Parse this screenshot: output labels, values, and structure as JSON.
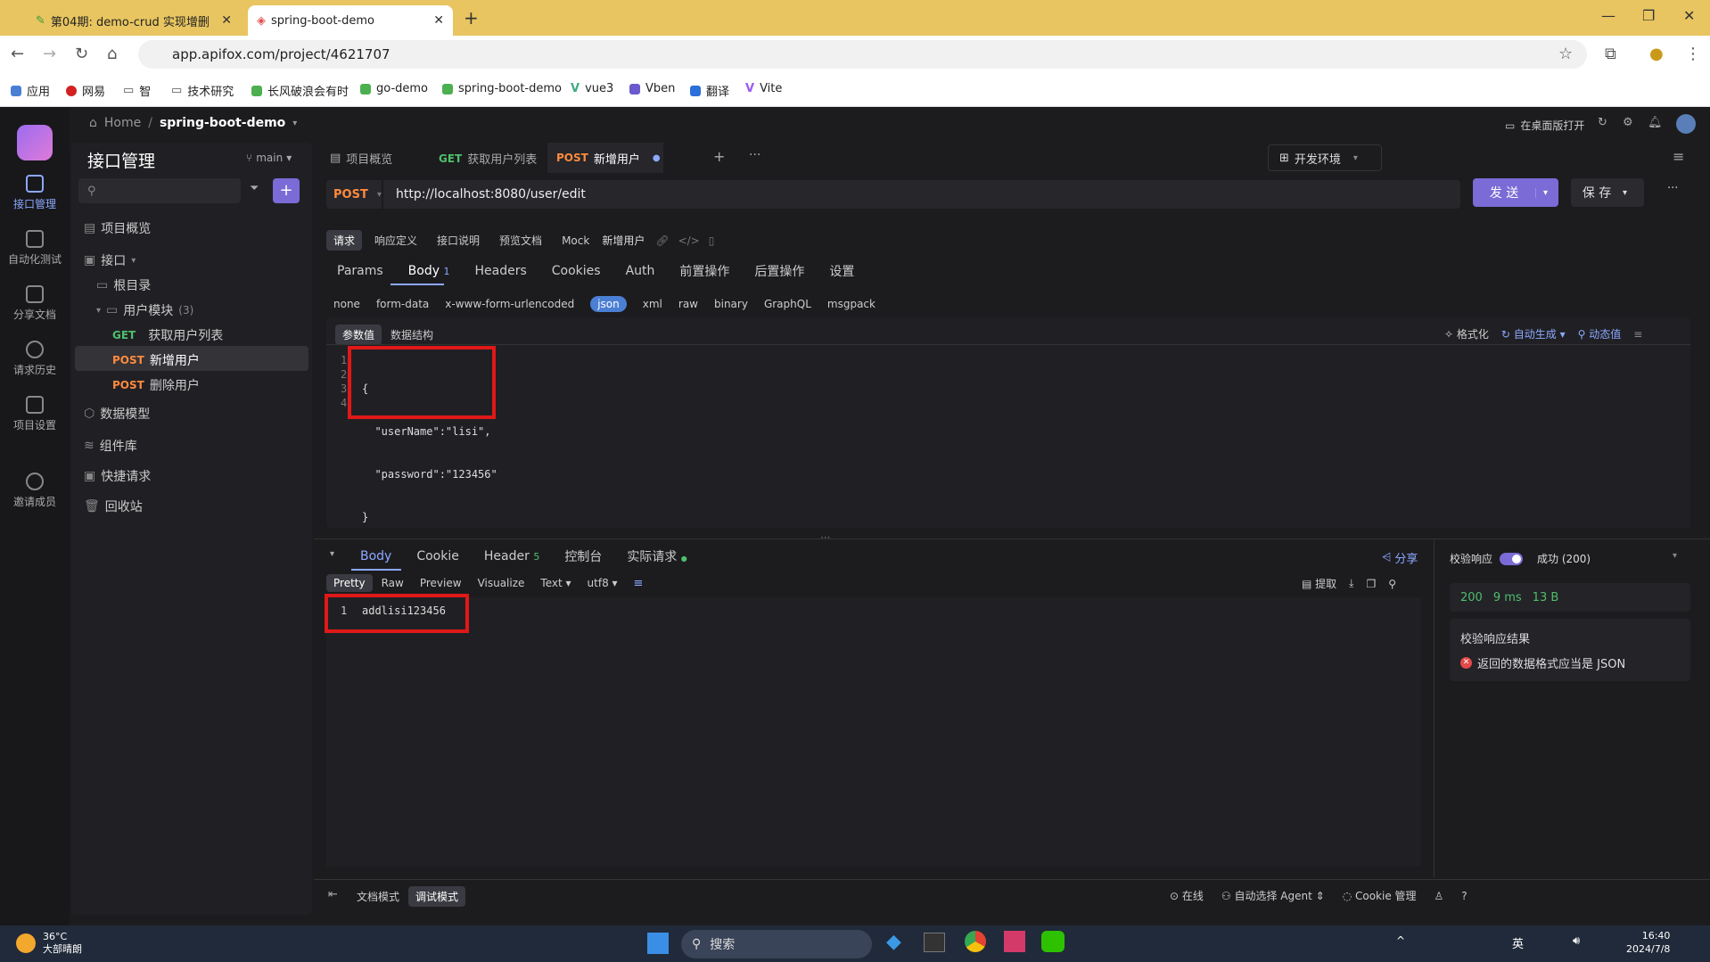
{
  "browser": {
    "tabs": [
      {
        "label": "第04期: demo-crud 实现增删",
        "active": false
      },
      {
        "label": "spring-boot-demo",
        "active": true
      }
    ],
    "url": "app.apifox.com/project/4621707",
    "bookmarks": [
      "应用",
      "网易",
      "智",
      "技术研究",
      "长风破浪会有时",
      "go-demo",
      "spring-boot-demo",
      "vue3",
      "Vben",
      "翻译",
      "Vite"
    ]
  },
  "header": {
    "home": "Home",
    "separator": "/",
    "project": "spring-boot-demo",
    "open_desktop": "在桌面版打开"
  },
  "rail": {
    "items": [
      "接口管理",
      "自动化测试",
      "分享文档",
      "请求历史",
      "项目设置",
      "邀请成员"
    ]
  },
  "sidebar": {
    "title": "接口管理",
    "branch": "main",
    "tree": {
      "overview": "项目概览",
      "api": "接口",
      "root": "根目录",
      "module": "用户模块",
      "module_count": "(3)",
      "endpoints": [
        {
          "method": "GET",
          "name": "获取用户列表"
        },
        {
          "method": "POST",
          "name": "新增用户"
        },
        {
          "method": "POST",
          "name": "删除用户"
        }
      ],
      "others": [
        "数据模型",
        "组件库",
        "快捷请求",
        "回收站"
      ]
    }
  },
  "main": {
    "tabs": [
      {
        "label": "项目概览",
        "method": ""
      },
      {
        "label": "获取用户列表",
        "method": "GET"
      },
      {
        "label": "新增用户",
        "method": "POST"
      }
    ],
    "env": "开发环境",
    "method": "POST",
    "url": "http://localhost:8080/user/edit",
    "send": "发 送",
    "save": "保 存",
    "subtabs": [
      "请求",
      "响应定义",
      "接口说明",
      "预览文档",
      "Mock"
    ],
    "api_name": "新增用户",
    "request_tabs": [
      "Params",
      "Body",
      "Headers",
      "Cookies",
      "Auth",
      "前置操作",
      "后置操作",
      "设置"
    ],
    "body_count": "1",
    "body_types": [
      "none",
      "form-data",
      "x-www-form-urlencoded",
      "json",
      "xml",
      "raw",
      "binary",
      "GraphQL",
      "msgpack"
    ],
    "body_views": [
      "参数值",
      "数据结构"
    ],
    "editor_actions": [
      "格式化",
      "自动生成",
      "动态值"
    ],
    "code": {
      "line_numbers": [
        "1",
        "2",
        "3",
        "4"
      ],
      "lines": [
        "{",
        "  \"userName\":\"lisi\",",
        "  \"password\":\"123456\"",
        "}"
      ]
    },
    "response": {
      "tabs": [
        "Body",
        "Cookie",
        "Header",
        "控制台",
        "实际请求"
      ],
      "header_count": "5",
      "share": "分享",
      "views": [
        "Pretty",
        "Raw",
        "Preview",
        "Visualize"
      ],
      "format": "Text",
      "encoding": "utf8",
      "actions": [
        "提取"
      ],
      "line_number": "1",
      "body": "addlisi123456",
      "validate_label": "校验响应",
      "status_select": "成功 (200)",
      "status": "200",
      "time": "9 ms",
      "size": "13 B",
      "validate_title": "校验响应结果",
      "validate_error": "返回的数据格式应当是 JSON"
    },
    "footer": {
      "modes": [
        "文档模式",
        "调试模式"
      ],
      "right": [
        "在线",
        "自动选择 Agent",
        "Cookie 管理"
      ]
    }
  },
  "taskbar": {
    "temp": "36°C",
    "weather": "大部晴朗",
    "search": "搜索",
    "lang": "英",
    "time": "16:40",
    "date": "2024/7/8"
  }
}
